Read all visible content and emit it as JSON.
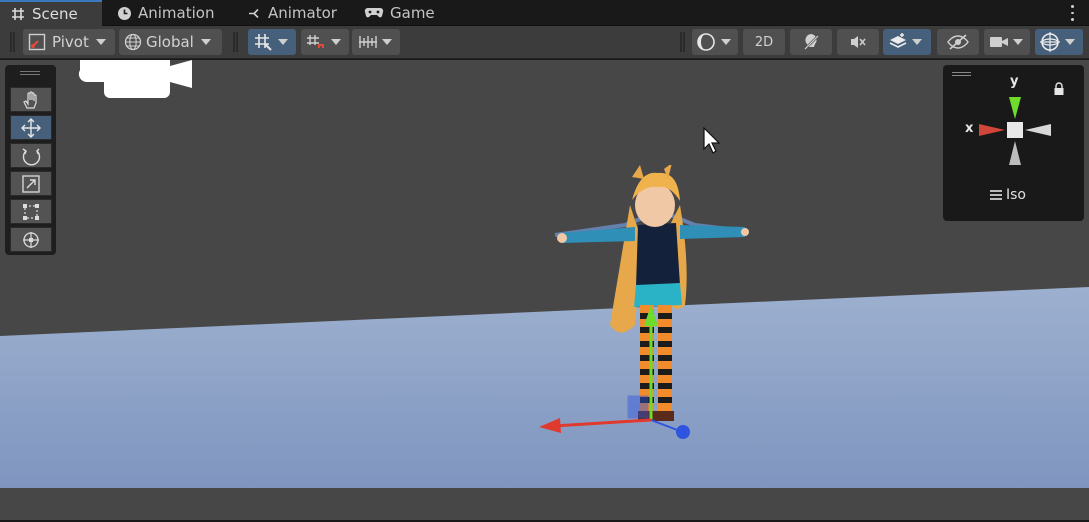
{
  "tabs": [
    {
      "label": "Scene",
      "icon": "grid-icon",
      "active": true
    },
    {
      "label": "Animation",
      "icon": "clock-icon",
      "active": false
    },
    {
      "label": "Animator",
      "icon": "branch-icon",
      "active": false
    },
    {
      "label": "Game",
      "icon": "gamepad-icon",
      "active": false
    }
  ],
  "toolbar": {
    "pivot_label": "Pivot",
    "global_label": "Global",
    "view_2d_label": "2D"
  },
  "gizmo": {
    "y_label": "y",
    "x_label": "x",
    "projection_label": "Iso"
  },
  "colors": {
    "accent": "#46607c",
    "tab_highlight": "#3a79bb",
    "ground": "#8fa4c9",
    "x_axis": "#e03a2e",
    "y_axis": "#6fdc2c",
    "z_axis": "#2f54e0"
  }
}
